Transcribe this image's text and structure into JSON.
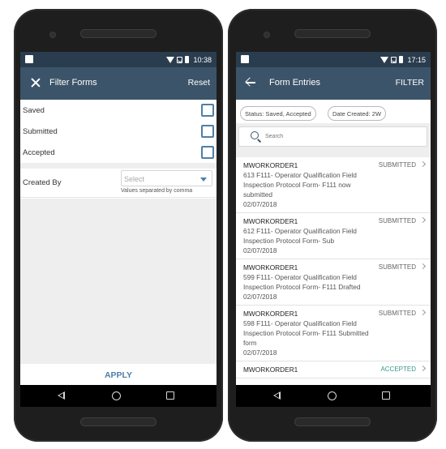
{
  "left_phone": {
    "status_bar": {
      "time": "10:38"
    },
    "app_bar": {
      "title": "Filter Forms",
      "action": "Reset"
    },
    "filters": [
      {
        "label": "Saved",
        "checked": false
      },
      {
        "label": "Submitted",
        "checked": false
      },
      {
        "label": "Accepted",
        "checked": false
      }
    ],
    "created_by": {
      "label": "Created By",
      "placeholder": "Select",
      "hint": "Values separated by comma"
    },
    "apply_label": "APPLY"
  },
  "right_phone": {
    "status_bar": {
      "time": "17:15"
    },
    "app_bar": {
      "title": "Form Entries",
      "action": "FILTER"
    },
    "chips": [
      "Status: Saved, Accepted",
      "Date Created: 2W"
    ],
    "search": {
      "placeholder": "Search"
    },
    "entries": [
      {
        "order": "MWORKORDER1",
        "status": "SUBMITTED",
        "description": "613 F111- Operator Qualification Field Inspection Protocol Form- F111 now submitted",
        "date": "02/07/2018"
      },
      {
        "order": "MWORKORDER1",
        "status": "SUBMITTED",
        "description": "612 F111- Operator Qualification Field Inspection Protocol Form- Sub",
        "date": "02/07/2018"
      },
      {
        "order": "MWORKORDER1",
        "status": "SUBMITTED",
        "description": "599 F111- Operator Qualification Field Inspection Protocol Form- F111 Drafted",
        "date": "02/07/2018"
      },
      {
        "order": "MWORKORDER1",
        "status": "SUBMITTED",
        "description": "598 F111- Operator Qualification Field Inspection Protocol Form- F111 Submitted form",
        "date": "02/07/2018"
      },
      {
        "order": "MWORKORDER1",
        "status": "ACCEPTED",
        "description": "",
        "date": ""
      }
    ]
  },
  "colors": {
    "status_bar": "#2a3d4e",
    "app_bar": "#3c5469",
    "accent": "#4e7fa8",
    "accepted": "#3a9a8a"
  }
}
